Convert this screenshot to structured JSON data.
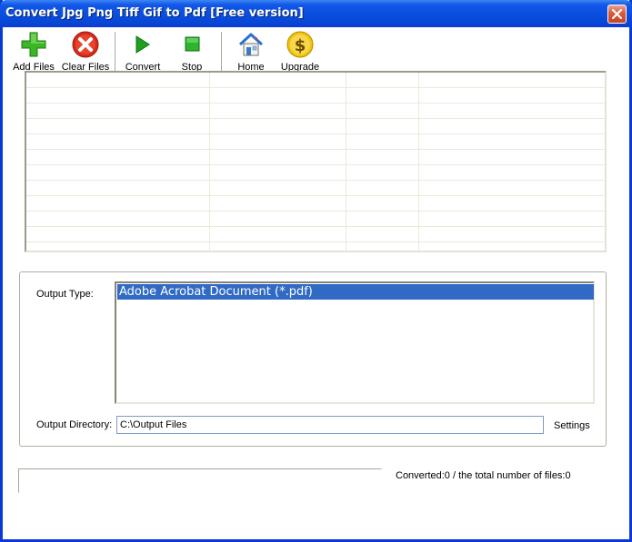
{
  "window": {
    "title": "Convert Jpg Png Tiff Gif to Pdf [Free version]"
  },
  "toolbar": {
    "buttons": [
      {
        "label": "Add Files",
        "icon": "plus-icon"
      },
      {
        "label": "Clear Files",
        "icon": "clear-icon"
      },
      {
        "label": "Convert",
        "icon": "play-icon"
      },
      {
        "label": "Stop",
        "icon": "stop-icon"
      },
      {
        "label": "Home",
        "icon": "home-icon"
      },
      {
        "label": "Upgrade",
        "icon": "dollar-icon"
      }
    ]
  },
  "file_list": {
    "rows": []
  },
  "output": {
    "type_label": "Output Type:",
    "type_options": [
      "Adobe Acrobat Document (*.pdf)"
    ],
    "selected_type": "Adobe Acrobat Document (*.pdf)",
    "directory_label": "Output Directory:",
    "directory_value": "C:\\Output Files",
    "settings_label": "Settings"
  },
  "status": {
    "progress": 0,
    "text": "Converted:0  /  the total number of files:0"
  },
  "colors": {
    "title_bar": "#0a4fe0",
    "selection": "#316ac5",
    "add_green": "#2ea11b",
    "clear_red": "#d62b1b",
    "upgrade_gold": "#e6b800"
  }
}
